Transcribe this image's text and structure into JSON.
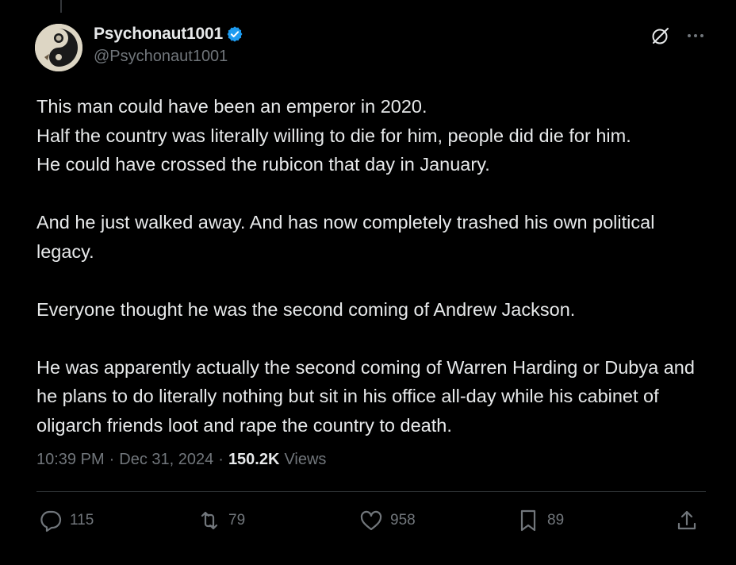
{
  "author": {
    "display_name": "Psychonaut1001",
    "handle": "@Psychonaut1001",
    "verified": true,
    "verified_color": "#1d9bf0"
  },
  "post": {
    "paragraphs": [
      "This man could have been an emperor in 2020.\nHalf the country was literally willing to die for him, people did die for him.\nHe could have crossed the rubicon that day in January.",
      "And he just walked away. And has now completely trashed his own political legacy.",
      "Everyone thought he was the second coming of Andrew Jackson.",
      "He was apparently actually the second coming of Warren Harding or Dubya and he plans to do literally nothing but sit in his office all-day while his cabinet of oligarch friends loot and rape the country to death."
    ]
  },
  "meta": {
    "time": "10:39 PM",
    "separator": "·",
    "date": "Dec 31, 2024",
    "views_count": "150.2K",
    "views_label": "Views"
  },
  "actions": {
    "replies": "115",
    "reposts": "79",
    "likes": "958",
    "bookmarks": "89"
  },
  "icons": {
    "top_right": [
      "grok-icon",
      "more-icon"
    ],
    "bar": [
      "reply-icon",
      "repost-icon",
      "like-icon",
      "bookmark-icon",
      "share-icon"
    ]
  },
  "theme": {
    "background": "#000000",
    "text": "#e7e9ea",
    "secondary": "#71767b",
    "divider": "#2f3336"
  }
}
